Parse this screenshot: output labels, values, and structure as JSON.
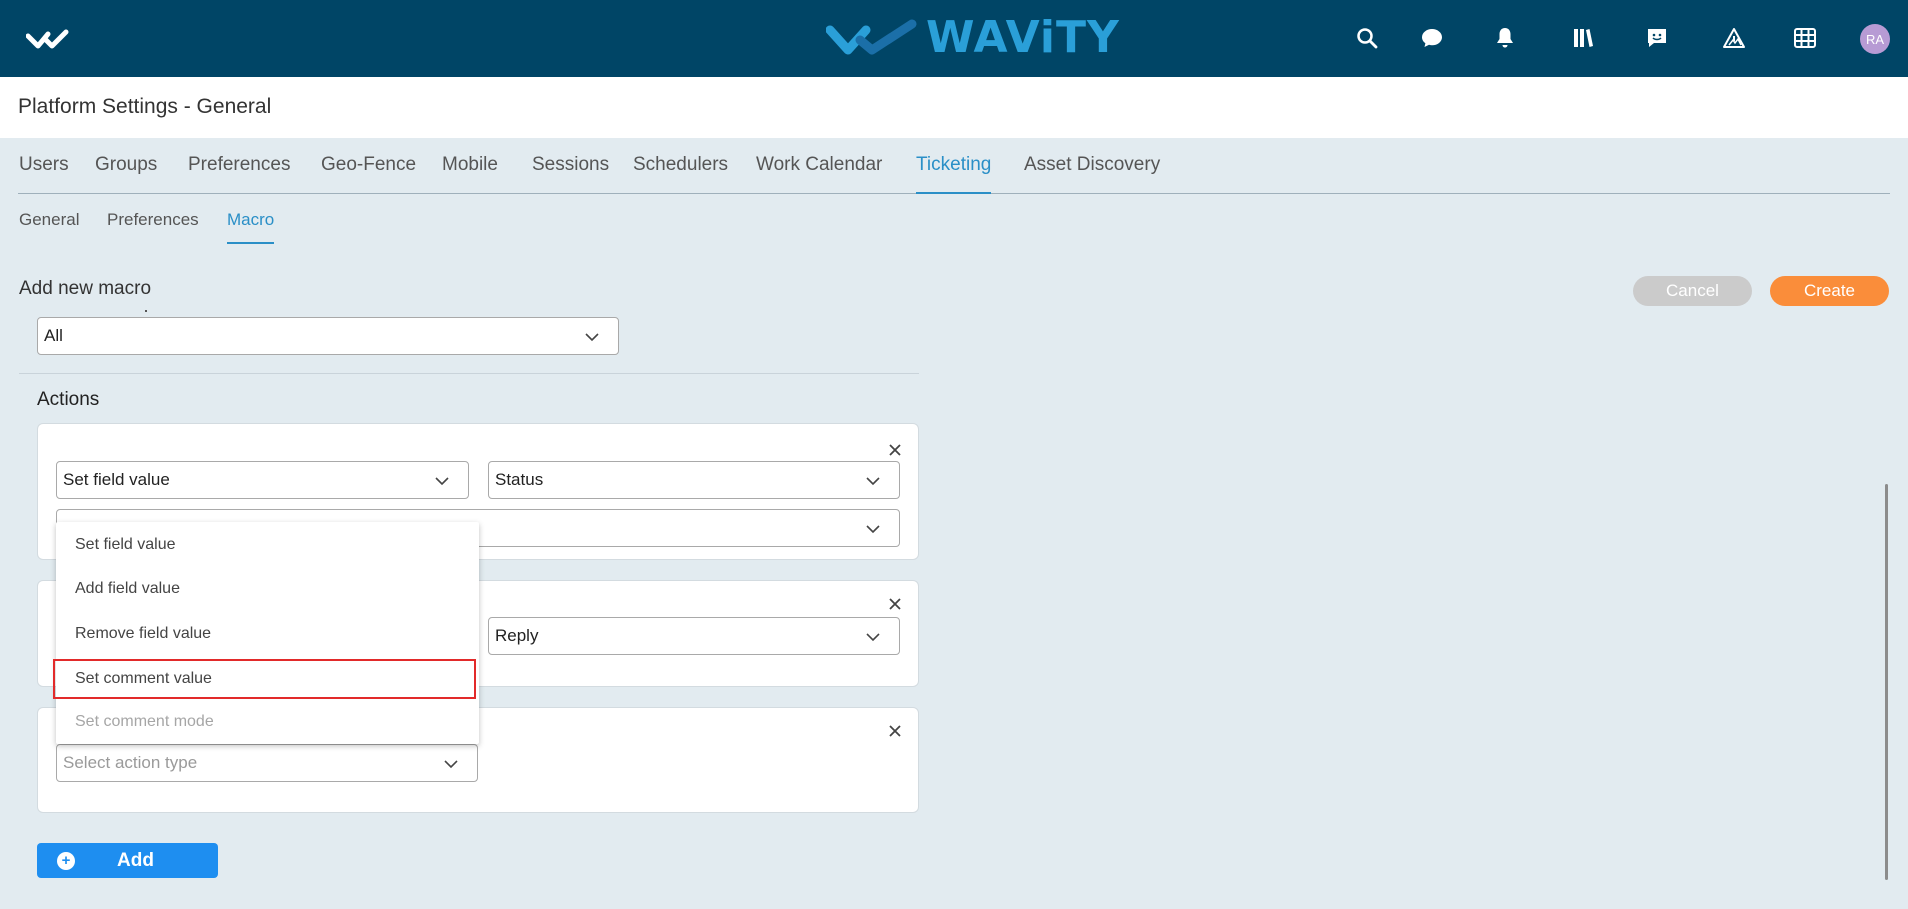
{
  "brand": {
    "name": "WAViTY"
  },
  "header_icons": [
    "search-icon",
    "chat-icon",
    "bell-icon",
    "library-icon",
    "feedback-icon",
    "alert-triangle-icon",
    "grid-icon"
  ],
  "user": {
    "initials": "RA"
  },
  "page": {
    "title": "Platform Settings - General"
  },
  "tabs": [
    {
      "label": "Users"
    },
    {
      "label": "Groups"
    },
    {
      "label": "Preferences"
    },
    {
      "label": "Geo-Fence"
    },
    {
      "label": "Mobile"
    },
    {
      "label": "Sessions"
    },
    {
      "label": "Schedulers"
    },
    {
      "label": "Work Calendar"
    },
    {
      "label": "Ticketing"
    },
    {
      "label": "Asset Discovery"
    }
  ],
  "subtabs": [
    {
      "label": "General"
    },
    {
      "label": "Preferences"
    },
    {
      "label": "Macro"
    }
  ],
  "form": {
    "title": "Add new macro",
    "cancel_label": "Cancel",
    "create_label": "Create",
    "scope_value": "All",
    "actions_title": "Actions"
  },
  "actions": [
    {
      "type": "Set field value",
      "field": "Status"
    },
    {
      "field": "Reply"
    },
    {
      "placeholder": "Select action type"
    }
  ],
  "dropdown": {
    "options": [
      {
        "label": "Set field value"
      },
      {
        "label": "Add field value"
      },
      {
        "label": "Remove field value"
      },
      {
        "label": "Set comment value"
      },
      {
        "label": "Set comment mode"
      }
    ]
  },
  "add_label": "Add",
  "colors": {
    "header": "#004566",
    "accent": "#2a8fc7",
    "create": "#fa8d3a",
    "add": "#1e8ef0",
    "highlight": "#e22a2a"
  }
}
